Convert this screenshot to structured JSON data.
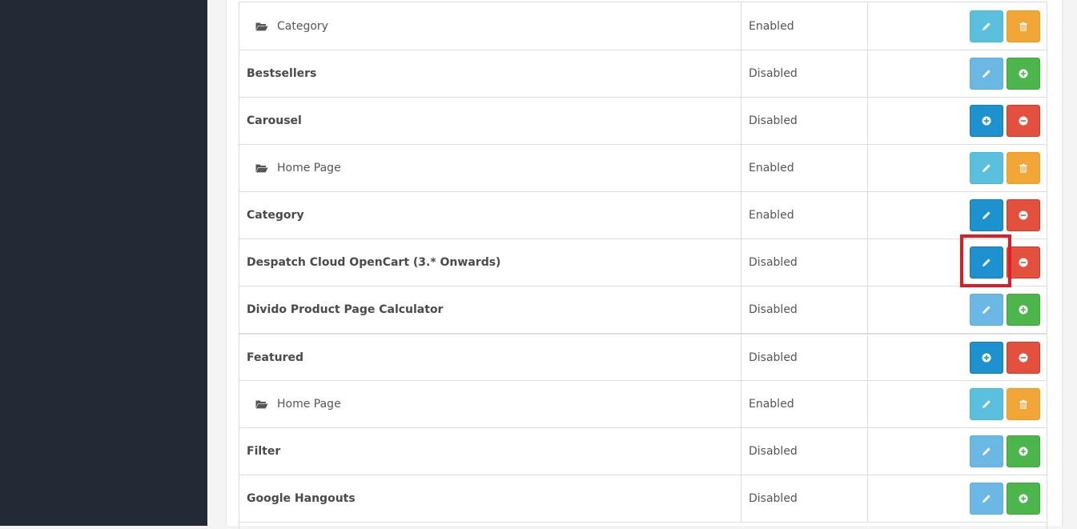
{
  "rows": [
    {
      "name": "Category",
      "child": true,
      "status": "Enabled",
      "actions": [
        "edit",
        "delete"
      ]
    },
    {
      "name": "Bestsellers",
      "child": false,
      "status": "Disabled",
      "actions": [
        "edit",
        "install"
      ]
    },
    {
      "name": "Carousel",
      "child": false,
      "status": "Disabled",
      "actions": [
        "add",
        "uninstall"
      ]
    },
    {
      "name": "Home Page",
      "child": true,
      "status": "Enabled",
      "actions": [
        "edit",
        "delete"
      ]
    },
    {
      "name": "Category",
      "child": false,
      "status": "Enabled",
      "actions": [
        "edit-primary",
        "uninstall"
      ]
    },
    {
      "name": "Despatch Cloud OpenCart (3.* Onwards)",
      "child": false,
      "status": "Disabled",
      "actions": [
        "edit-primary",
        "uninstall"
      ]
    },
    {
      "name": "Divido Product Page Calculator",
      "child": false,
      "status": "Disabled",
      "actions": [
        "edit",
        "install"
      ]
    },
    {
      "name": "Featured",
      "child": false,
      "status": "Disabled",
      "actions": [
        "add",
        "uninstall"
      ]
    },
    {
      "name": "Home Page",
      "child": true,
      "status": "Enabled",
      "actions": [
        "edit",
        "delete"
      ]
    },
    {
      "name": "Filter",
      "child": false,
      "status": "Disabled",
      "actions": [
        "edit",
        "install"
      ]
    },
    {
      "name": "Google Hangouts",
      "child": false,
      "status": "Disabled",
      "actions": [
        "edit",
        "install"
      ]
    }
  ],
  "icons": {
    "edit": "pencil-icon",
    "delete": "trash-icon",
    "install": "plus-circle-icon",
    "uninstall": "minus-circle-icon",
    "folder": "folder-open-icon"
  },
  "colors": {
    "sidebar": "#242a35",
    "info": "#5bc0de",
    "primary": "#1e91cf",
    "warning": "#f3a638",
    "success": "#4cb64c",
    "danger": "#e3503e",
    "highlight": "#e01b24"
  }
}
